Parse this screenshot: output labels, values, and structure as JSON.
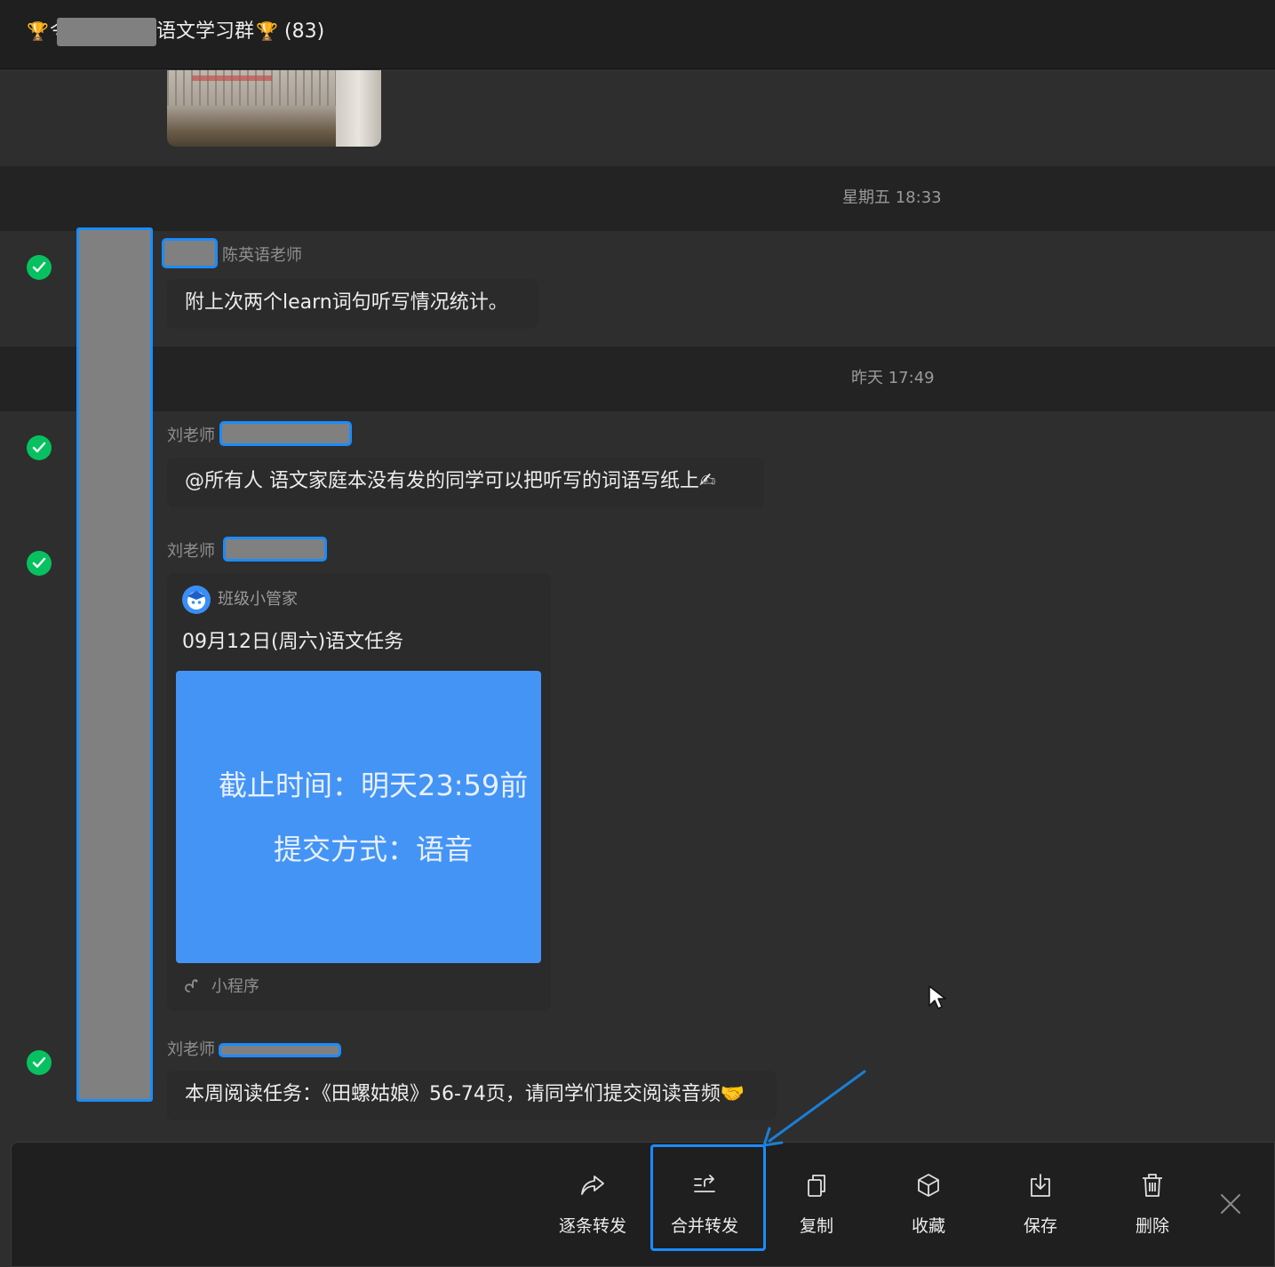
{
  "title_bar": {
    "trophy_left": "🏆",
    "prefix_char": "令",
    "title": "语文学习群",
    "trophy_right": "🏆",
    "count": "(83)"
  },
  "timestamps": [
    "星期五 18:33",
    "昨天 17:49"
  ],
  "messages": [
    {
      "sender": "陈英语老师",
      "text": "附上次两个learn词句听写情况统计。"
    },
    {
      "sender": "刘老师",
      "text": "@所有人 语文家庭本没有发的同学可以把听写的词语写纸上✍"
    },
    {
      "sender": "刘老师",
      "mini_program": {
        "app_name": "班级小管家",
        "title": "09月12日(周六)语文任务",
        "image_line1": "截止时间：明天23:59前",
        "image_line2": "提交方式：语音",
        "footer": "小程序"
      }
    },
    {
      "sender": "刘老师",
      "text": "本周阅读任务：《田螺姑娘》56-74页，请同学们提交阅读音频🤝"
    }
  ],
  "actions": {
    "forward_each": "逐条转发",
    "merge_forward": "合并转发",
    "copy": "复制",
    "favorite": "收藏",
    "save": "保存",
    "delete": "删除"
  },
  "colors": {
    "accent": "#1a8cff",
    "check": "#07c160",
    "card_image": "#4494f6"
  }
}
